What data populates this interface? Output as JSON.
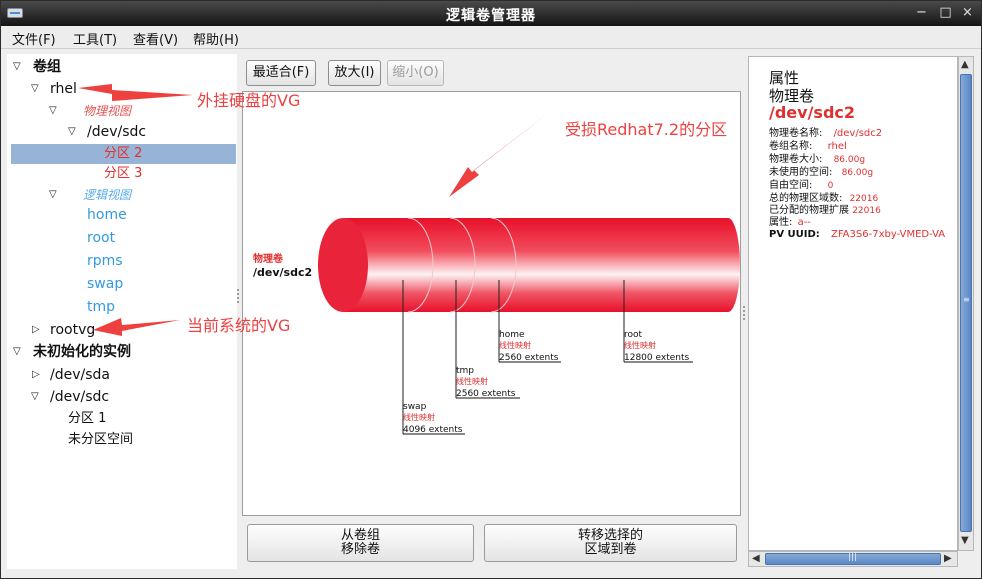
{
  "window": {
    "title": "逻辑卷管理器",
    "minimize": "−",
    "maximize": "□",
    "close": "×"
  },
  "menu": [
    "文件(F)",
    "工具(T)",
    "查看(V)",
    "帮助(H)"
  ],
  "tree": {
    "volume_groups": "卷组",
    "rhel": "rhel",
    "physical_view": "物理视图",
    "dev_sdc": "/dev/sdc",
    "partition_2": "分区 2",
    "partition_3": "分区 3",
    "logical_view": "逻辑视图",
    "lvs": [
      "home",
      "root",
      "rpms",
      "swap",
      "tmp"
    ],
    "rootvg": "rootvg",
    "uninitialized": "未初始化的实例",
    "dev_sda": "/dev/sda",
    "dev_sdc2": "/dev/sdc",
    "u_partition_1": "分区 1",
    "unpartitioned": "未分区空间"
  },
  "toolbar": {
    "fit": "最适合(F)",
    "zoom_in": "放大(I)",
    "zoom_out": "缩小(O)"
  },
  "diagram": {
    "pv_label": "物理卷",
    "pv_name": "/dev/sdc2",
    "segments": [
      {
        "name": "swap",
        "type": "线性映射",
        "extents": "4096 extents"
      },
      {
        "name": "tmp",
        "type": "线性映射",
        "extents": "2560 extents"
      },
      {
        "name": "home",
        "type": "线性映射",
        "extents": "2560 extents"
      },
      {
        "name": "root",
        "type": "线性映射",
        "extents": "12800 extents"
      }
    ]
  },
  "buttons": {
    "remove_from_vg": [
      "从卷组",
      "移除卷"
    ],
    "migrate": [
      "转移选择的",
      "区域到卷"
    ]
  },
  "properties": {
    "heading": "属性",
    "type": "物理卷",
    "name": "/dev/sdc2",
    "rows": [
      {
        "key": "物理卷名称:",
        "val": "/dev/sdc2"
      },
      {
        "key": "卷组名称:",
        "val": "rhel"
      },
      {
        "key": "物理卷大小:",
        "val": "86.00g"
      },
      {
        "key": "未使用的空间:",
        "val": "86.00g"
      },
      {
        "key": "自由空间:",
        "val": "0"
      },
      {
        "key": "总的物理区域数:",
        "val": "22016"
      },
      {
        "key": "已分配的物理扩展",
        "val": "22016"
      },
      {
        "key": "属性:",
        "val": "a--"
      },
      {
        "key": "PV UUID:",
        "val": "ZFA3S6-7xby-VMED-VA"
      }
    ]
  },
  "annotations": {
    "external_vg": "外挂硬盘的VG",
    "damaged_partition": "受损Redhat7.2的分区",
    "current_vg": "当前系统的VG"
  },
  "colors": {
    "annotation": "#ef4040",
    "cylinder": "#e8233a",
    "selection": "#97b4d6"
  }
}
